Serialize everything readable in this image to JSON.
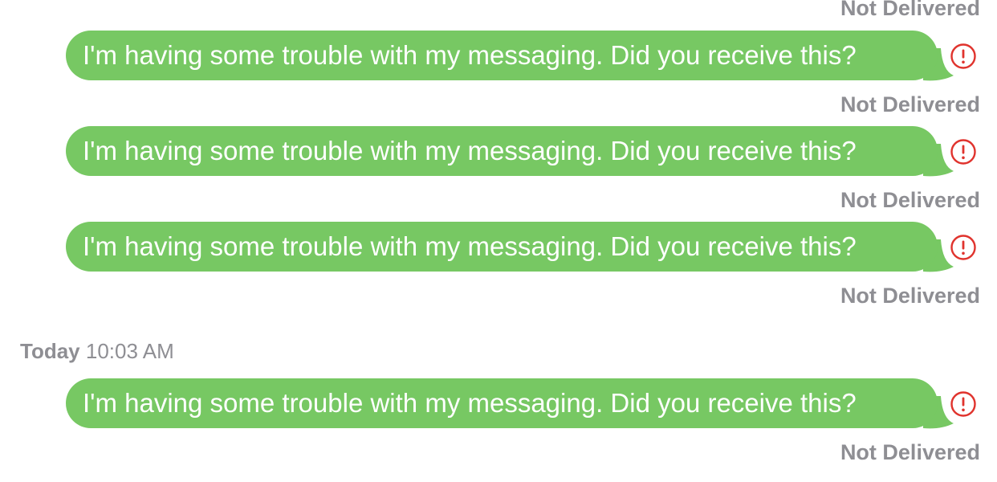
{
  "colors": {
    "bubble_green": "#77c863",
    "status_gray": "#8e8e93",
    "error_red": "#e0332d"
  },
  "conversation": {
    "top_status": "Not Delivered",
    "messages": [
      {
        "text": "I'm having some trouble with my messaging. Did you receive this?",
        "status": "Not Delivered",
        "icon": "exclamation-circle-icon"
      },
      {
        "text": "I'm having some trouble with my messaging. Did you receive this?",
        "status": "Not Delivered",
        "icon": "exclamation-circle-icon"
      },
      {
        "text": "I'm having some trouble with my messaging. Did you receive this?",
        "status": "Not Delivered",
        "icon": "exclamation-circle-icon"
      },
      {
        "text": "I'm having some trouble with my messaging. Did you receive this?",
        "status": "Not Delivered",
        "icon": "exclamation-circle-icon"
      }
    ],
    "timestamp": {
      "day": "Today",
      "time": "10:03 AM"
    }
  }
}
